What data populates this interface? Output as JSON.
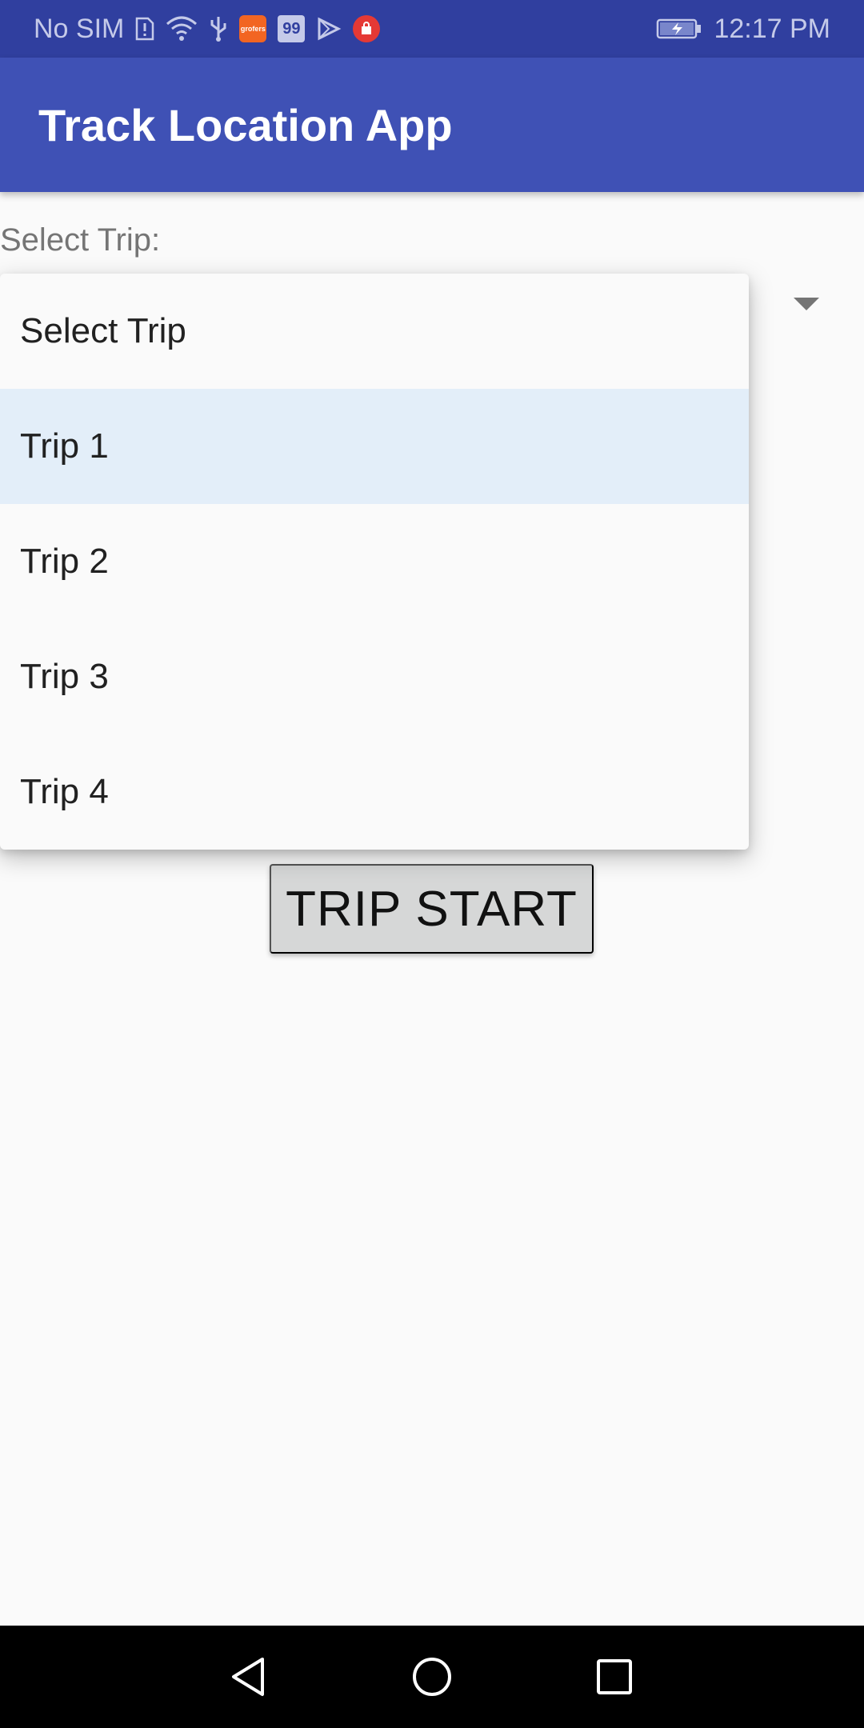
{
  "status_bar": {
    "carrier": "No SIM",
    "time": "12:17 PM",
    "icons": [
      "sim-alert-icon",
      "wifi-icon",
      "usb-icon",
      "grofers-app-icon",
      "99-app-icon",
      "play-icon",
      "red-bag-app-icon",
      "battery-charging-icon"
    ],
    "grofers_label": "grofers",
    "ninety_nine_label": "99",
    "colors": {
      "background": "#303f9f",
      "text": "#c5cae9"
    }
  },
  "app_bar": {
    "title": "Track Location App",
    "color": "#3f51b5"
  },
  "form": {
    "label": "Select Trip:"
  },
  "dropdown": {
    "selected_index": 1,
    "options": [
      "Select Trip",
      "Trip 1",
      "Trip 2",
      "Trip 3",
      "Trip 4"
    ]
  },
  "actions": {
    "trip_start_label": "TRIP START"
  },
  "nav_bar": {
    "icons": [
      "back-icon",
      "home-icon",
      "recents-icon"
    ]
  }
}
